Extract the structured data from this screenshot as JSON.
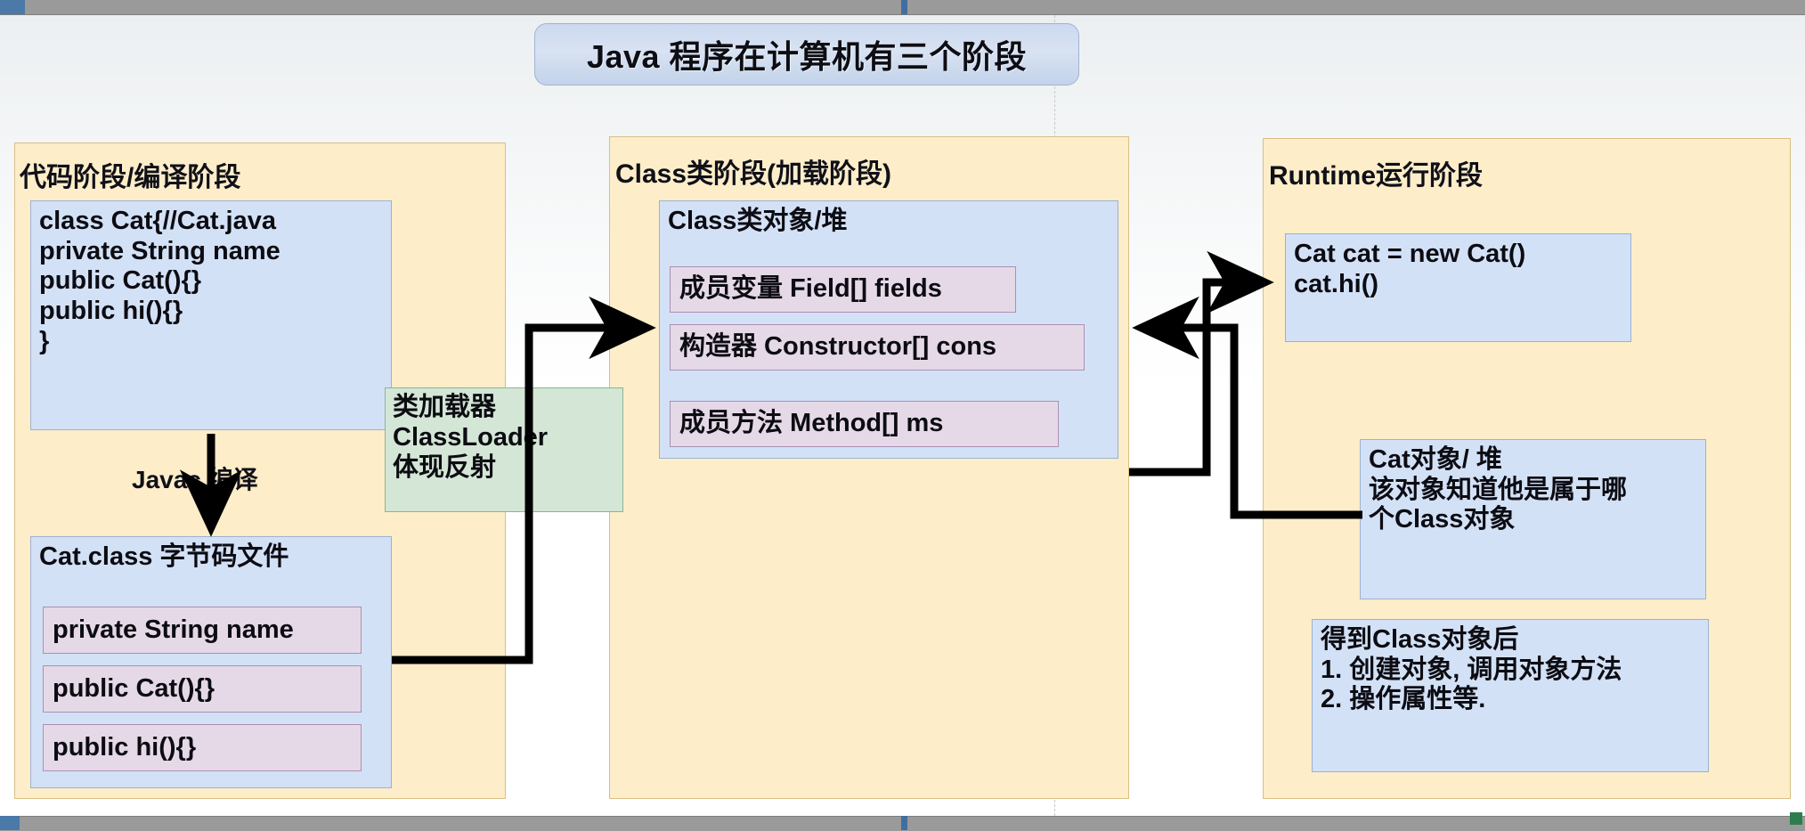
{
  "title": {
    "text": "Java 程序在计算机有三个阶段"
  },
  "stages": [
    {
      "id": "code-stage",
      "title": "代码阶段/编译阶段",
      "source_box": {
        "name": "source-code-box",
        "text": "class Cat{//Cat.java\nprivate String name\npublic Cat(){}\npublic hi(){}\n}"
      },
      "compile_label": "Javac 编译",
      "class_file_box": {
        "name": "class-file-box",
        "title": "Cat.class 字节码文件",
        "members": [
          "private String name",
          "public Cat(){}",
          "public hi(){}"
        ]
      }
    },
    {
      "id": "class-stage",
      "title": "Class类阶段(加载阶段)",
      "class_object_box": {
        "name": "class-object-box",
        "title": "Class类对象/堆",
        "members": [
          "成员变量 Field[] fields",
          "构造器 Constructor[] cons",
          "成员方法 Method[] ms"
        ]
      }
    },
    {
      "id": "runtime-stage",
      "title": "Runtime运行阶段",
      "runtime_code_box": {
        "name": "runtime-code-box",
        "text": "Cat cat = new Cat()\ncat.hi()"
      },
      "cat_object_box": {
        "name": "cat-object-box",
        "text": "Cat对象/ 堆\n该对象知道他是属于哪\n个Class对象"
      },
      "usage_box": {
        "name": "class-usage-box",
        "text": "得到Class对象后\n1. 创建对象, 调用对象方法\n2. 操作属性等."
      }
    }
  ],
  "classloader_note": {
    "name": "classloader-note",
    "text": "类加载器\nClassLoader\n体现反射"
  },
  "colors": {
    "panel_fill": "#fdedc9",
    "panel_border": "#d9bf85",
    "blue_fill": "#d3e1f7",
    "blue_border": "#9bb2cf",
    "pink_fill": "#e5d9e7",
    "pink_border": "#ab8fb4",
    "green_fill": "#d4e6d6",
    "green_border": "#8cb592",
    "title_fill": "#d2dcf0",
    "arrow": "#000000"
  }
}
